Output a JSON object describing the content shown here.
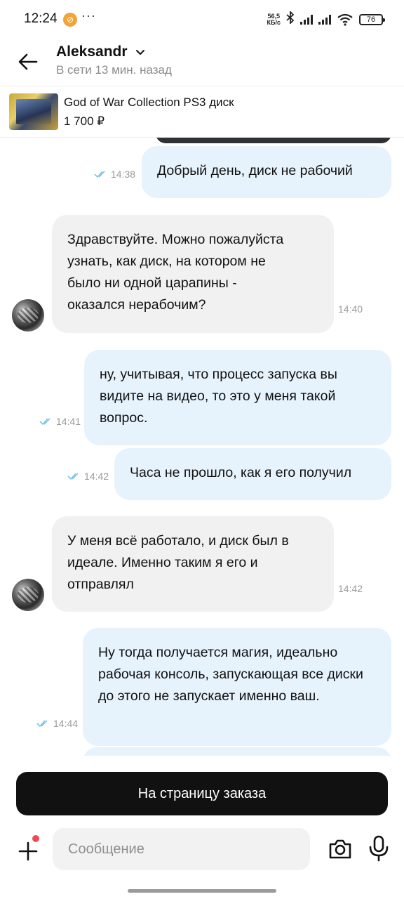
{
  "status_bar": {
    "time": "12:24",
    "badge_icon": "notification-badge-icon",
    "dots": "···",
    "net_speed_value": "56,5",
    "net_speed_unit": "КБ/с",
    "battery": "76"
  },
  "header": {
    "name": "Aleksandr",
    "last_seen": "В сети 13 мин. назад"
  },
  "product": {
    "title": "God of War Collection PS3 диск",
    "price": "1 700 ₽"
  },
  "messages": [
    {
      "direction": "out",
      "text": "Добрый день, диск не рабочий",
      "time": "14:38"
    },
    {
      "direction": "in",
      "text": "Здравствуйте. Можно пожалуйста узнать, как диск, на котором не было ни одной царапины - оказался нерабочим?",
      "time": "14:40"
    },
    {
      "direction": "out",
      "text": "ну, учитывая, что процесс запуска вы видите на видео, то это у меня такой вопрос.",
      "time": "14:41"
    },
    {
      "direction": "out",
      "text": "Часа не прошло, как я его получил",
      "time": "14:42"
    },
    {
      "direction": "in",
      "text": "У меня всё работало, и диск был в идеале. Именно таким я его и отправлял",
      "time": "14:42"
    },
    {
      "direction": "out",
      "text": "Ну тогда получается магия, идеально рабочая консоль, запускающая все диски до этого не запускает именно ваш.",
      "time": "14:44"
    }
  ],
  "bottom": {
    "order_button": "На страницу заказа",
    "message_placeholder": "Сообщение"
  },
  "colors": {
    "outgoing_bubble": "#e6f3fd",
    "incoming_bubble": "#f1f1f1",
    "primary_button": "#111111",
    "read_check": "#7fc1ea",
    "notification_dot": "#f04b57"
  }
}
